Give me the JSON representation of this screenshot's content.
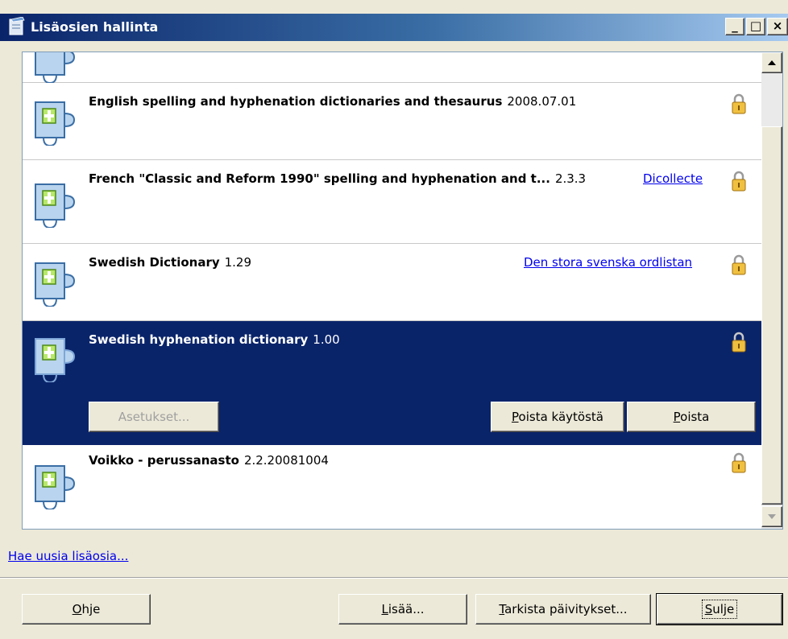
{
  "window": {
    "title": "Lisäosien hallinta",
    "caption_buttons": [
      "_",
      "□",
      "×"
    ]
  },
  "extensions": [
    {
      "name": "English spelling and hyphenation dictionaries and thesaurus",
      "version": "2008.07.01",
      "link": "",
      "icon": "puzzle-icon",
      "locked": true
    },
    {
      "name": "French \"Classic and Reform 1990\" spelling and hyphenation and t...",
      "version": "2.3.3",
      "link": "Dicollecte",
      "icon": "puzzle-icon",
      "locked": true
    },
    {
      "name": "Swedish Dictionary",
      "version": "1.29",
      "link": "Den stora svenska ordlistan",
      "icon": "puzzle-icon",
      "locked": true
    },
    {
      "name": "Swedish hyphenation dictionary",
      "version": "1.00",
      "link": "",
      "icon": "puzzle-icon",
      "locked": true,
      "selected": true,
      "actions": {
        "options": "Asetukset...",
        "disable": "Poista käytöstä",
        "remove": "Poista"
      }
    },
    {
      "name": "Voikko - perussanasto",
      "version": "2.2.20081004",
      "link": "",
      "icon": "puzzle-icon",
      "locked": true
    }
  ],
  "get_more_link": "Hae uusia lisäosia...",
  "footer": {
    "help": "Ohje",
    "add": "Lisää...",
    "check_updates": "Tarkista päivitykset...",
    "close": "Sulje"
  },
  "colors": {
    "selection": "#0a246a",
    "link": "#0000ee",
    "titlebar_start": "#0a246a",
    "titlebar_end": "#a6caf0"
  }
}
